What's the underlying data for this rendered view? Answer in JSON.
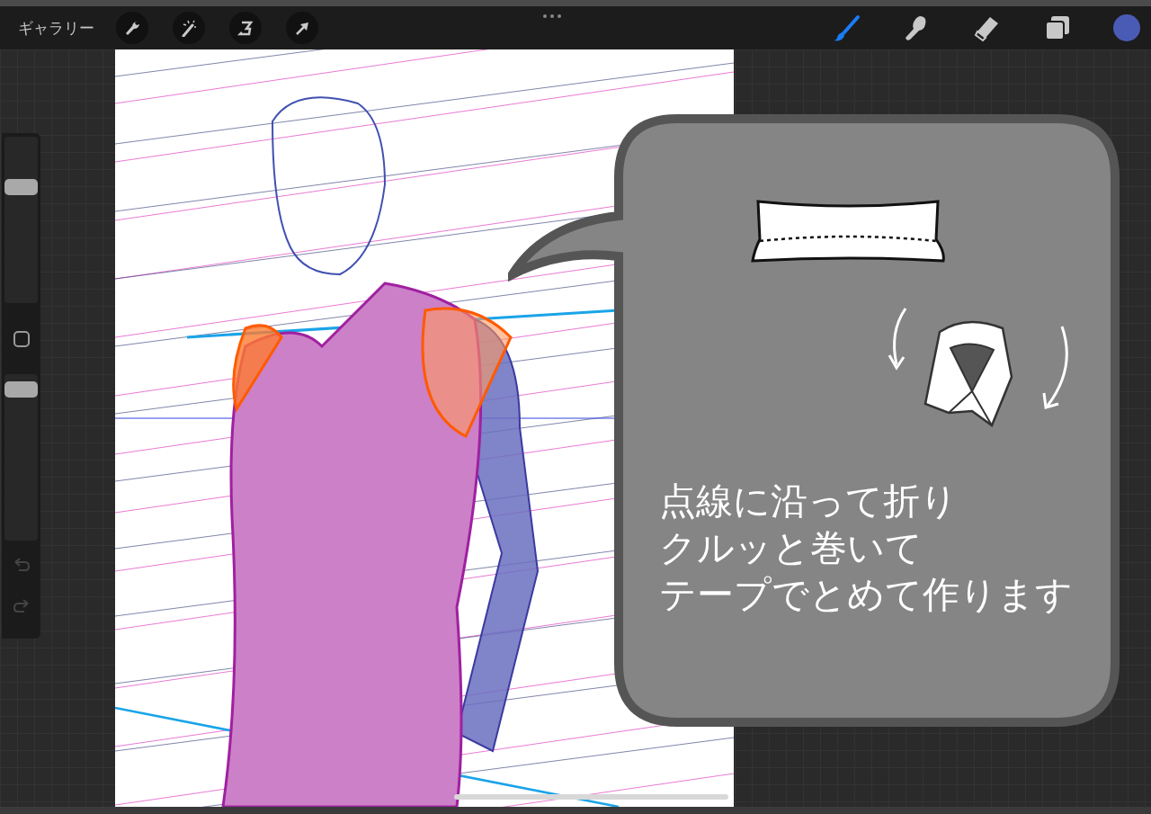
{
  "topbar": {
    "gallery": "ギャラリー"
  },
  "tools": [
    {
      "kind": "brush",
      "selected": true
    },
    {
      "kind": "smudge",
      "selected": false
    },
    {
      "kind": "eraser",
      "selected": false
    },
    {
      "kind": "layers",
      "selected": false
    },
    {
      "kind": "color",
      "selected": false,
      "color": "#4a5bb5"
    }
  ],
  "sidebar": {
    "size_slider": {
      "level": 0.72
    },
    "opacity_slider": {
      "level": 0.95
    }
  },
  "bubble": {
    "lines": [
      "点線に沿って折り",
      "クルッと巻いて",
      "テープでとめて作ります"
    ]
  }
}
